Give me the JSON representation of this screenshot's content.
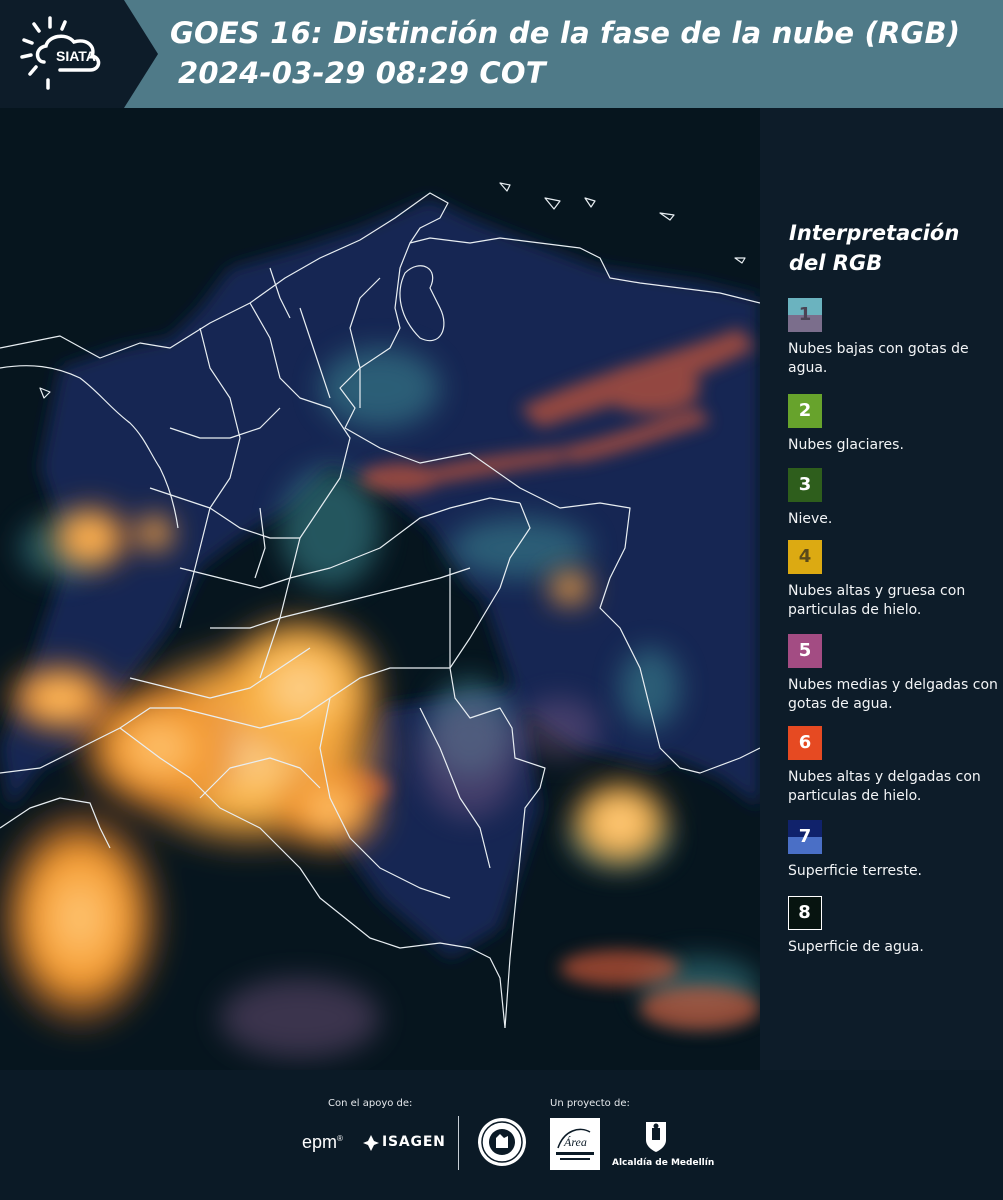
{
  "header": {
    "logo_text": "SIATA",
    "title_line1": "GOES 16: Distinción de la fase de la nube (RGB)",
    "title_line2": "2024-03-29 08:29 COT",
    "background_color": "#4f7a88"
  },
  "legend": {
    "title_line1": "Interpretación",
    "title_line2": "del RGB",
    "items": [
      {
        "num": "1",
        "label": "Nubes bajas con gotas de agua.",
        "color_top": "#6bb3bf",
        "color_bottom": "#7b6e8c"
      },
      {
        "num": "2",
        "label": "Nubes glaciares.",
        "color_top": "#67a32c",
        "color_bottom": "#67a32c"
      },
      {
        "num": "3",
        "label": "Nieve.",
        "color_top": "#2e5e1c",
        "color_bottom": "#2e5e1c"
      },
      {
        "num": "4",
        "label": "Nubes altas y gruesa con particulas de hielo.",
        "color_top": "#dcaa12",
        "color_bottom": "#dcaa12"
      },
      {
        "num": "5",
        "label": "Nubes medias y delgadas con gotas de agua.",
        "color_top": "#a34c83",
        "color_bottom": "#a34c83"
      },
      {
        "num": "6",
        "label": "Nubes altas y delgadas con particulas de hielo.",
        "color_top": "#e64a22",
        "color_bottom": "#e64a22"
      },
      {
        "num": "7",
        "label": "Superficie terreste.",
        "color_top": "#10226b",
        "color_bottom": "#4a6fc6"
      },
      {
        "num": "8",
        "label": "Superficie de agua.",
        "color_top": "#071410",
        "color_bottom": "#071410"
      }
    ]
  },
  "footer": {
    "apoyo_label": "Con el apoyo de:",
    "proyecto_label": "Un proyecto de:",
    "epm_text": "epm",
    "isagen_text": "ISAGEN",
    "area_text": "Área",
    "alcaldia_text": "Alcaldía de Medellín"
  }
}
